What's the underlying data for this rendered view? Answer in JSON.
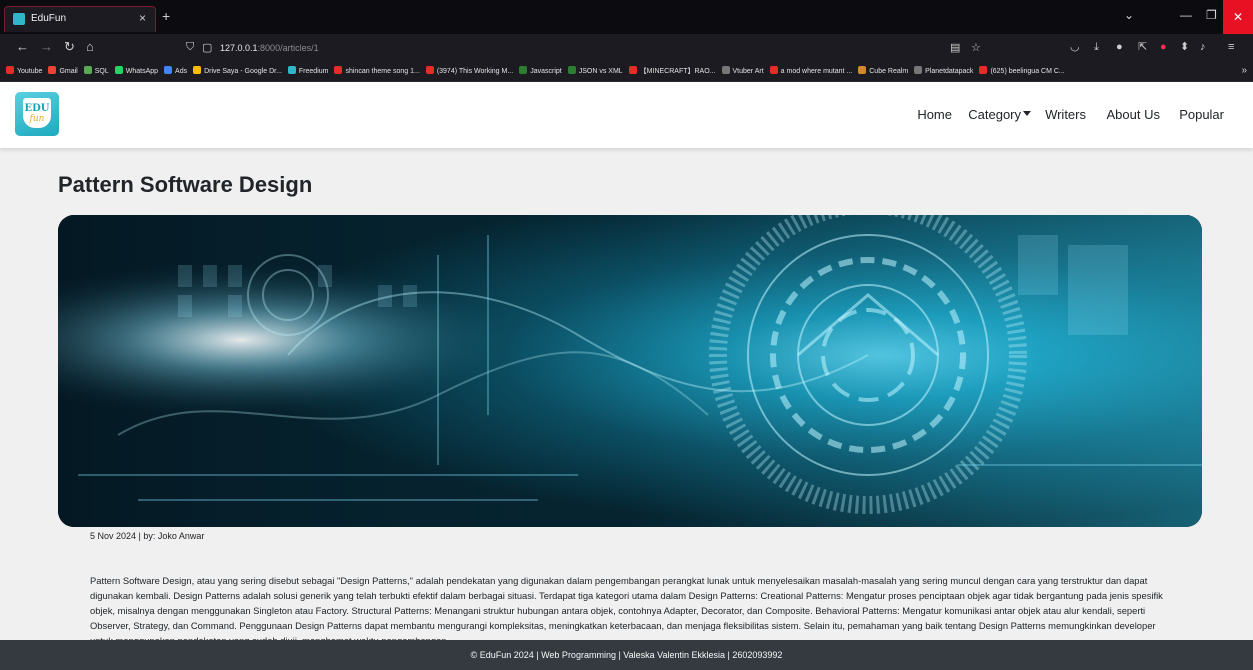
{
  "browser": {
    "tab_title": "EduFun",
    "tab_close": "×",
    "new_tab": "+",
    "url_host": "127.0.0.1",
    "url_path": ":8000/articles/1",
    "bookmarks": [
      {
        "label": "Youtube",
        "color": "#e52d27"
      },
      {
        "label": "Gmail",
        "color": "#ea4335"
      },
      {
        "label": "SQL",
        "color": "#5aa84f"
      },
      {
        "label": "WhatsApp",
        "color": "#25d366"
      },
      {
        "label": "Ads",
        "color": "#4285f4"
      },
      {
        "label": "Drive Saya - Google Dr...",
        "color": "#fbbc04"
      },
      {
        "label": "Freedium",
        "color": "#2fb7c9"
      },
      {
        "label": "shincan theme song 1...",
        "color": "#e52d27"
      },
      {
        "label": "(3974) This Working M...",
        "color": "#e52d27"
      },
      {
        "label": "Javascript",
        "color": "#2f7d32"
      },
      {
        "label": "JSON vs XML",
        "color": "#2f7d32"
      },
      {
        "label": "【MINECRAFT】RAO...",
        "color": "#e52d27"
      },
      {
        "label": "Vtuber Art",
        "color": "#777777"
      },
      {
        "label": "a mod where mutant ...",
        "color": "#e52d27"
      },
      {
        "label": "Cube Realm",
        "color": "#d08a2a"
      },
      {
        "label": "Planetdatapack",
        "color": "#777777"
      },
      {
        "label": "(625) beelingua CM C...",
        "color": "#e52d27"
      }
    ]
  },
  "site": {
    "logo_top": "EDU",
    "logo_bottom": "fun",
    "nav": {
      "home": "Home",
      "category": "Category",
      "writers": "Writers",
      "about": "About Us",
      "popular": "Popular"
    }
  },
  "article": {
    "title": "Pattern Software Design",
    "meta": "5 Nov 2024 | by: Joko Anwar",
    "body": "Pattern Software Design, atau yang sering disebut sebagai \"Design Patterns,\" adalah pendekatan yang digunakan dalam pengembangan perangkat lunak untuk menyelesaikan masalah-masalah yang sering muncul dengan cara yang terstruktur dan dapat digunakan kembali. Design Patterns adalah solusi generik yang telah terbukti efektif dalam berbagai situasi. Terdapat tiga kategori utama dalam Design Patterns: Creational Patterns: Mengatur proses penciptaan objek agar tidak bergantung pada jenis spesifik objek, misalnya dengan menggunakan Singleton atau Factory. Structural Patterns: Menangani struktur hubungan antara objek, contohnya Adapter, Decorator, dan Composite. Behavioral Patterns: Mengatur komunikasi antar objek atau alur kendali, seperti Observer, Strategy, dan Command. Penggunaan Design Patterns dapat membantu mengurangi kompleksitas, meningkatkan keterbacaan, dan menjaga fleksibilitas sistem. Selain itu, pemahaman yang baik tentang Design Patterns memungkinkan developer untuk menggunakan pendekatan yang sudah diuji, menghemat waktu pengembangan."
  },
  "footer": {
    "text": "© EduFun 2024 | Web Programming | Valeska Valentin Ekklesia | 2602093992"
  }
}
